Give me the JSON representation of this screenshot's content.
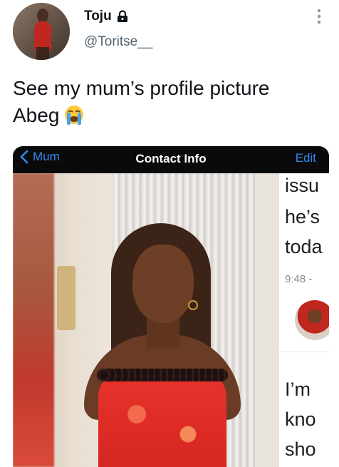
{
  "tweet": {
    "display_name": "Toju",
    "handle": "@Toritse__",
    "text_line1": "See my mum’s profile picture",
    "text_line2": "Abeg",
    "emoji": "loudly-crying-face"
  },
  "icons": {
    "lock": "lock-icon",
    "more": "more-vertical-icon",
    "back": "chevron-left-icon"
  },
  "screenshot": {
    "nav": {
      "back_label": "Mum",
      "title": "Contact Info",
      "edit_label": "Edit"
    },
    "chat": {
      "line1": "issu",
      "line2": "he’s",
      "line3": "toda",
      "time": "9:48 -",
      "line4": "I’m",
      "line5": "kno",
      "line6": "sho"
    }
  },
  "colors": {
    "ios_blue": "#2e8cf0",
    "handle_gray": "#536471",
    "text": "#0f1419"
  }
}
